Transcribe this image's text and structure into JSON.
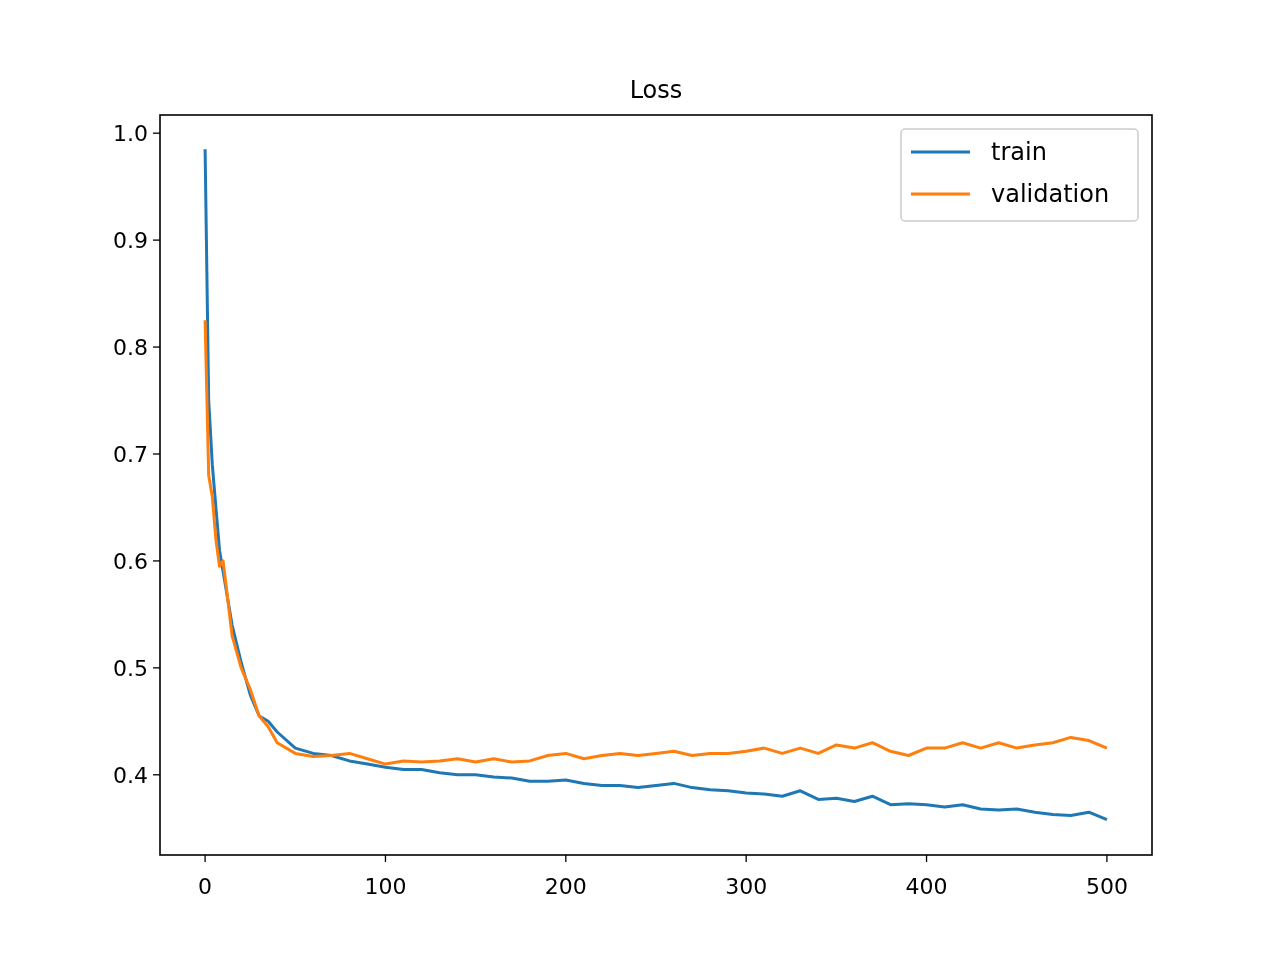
{
  "figure": {
    "chart_data": {
      "type": "line",
      "title": "Loss",
      "x": [
        0,
        2,
        4,
        6,
        8,
        10,
        15,
        20,
        25,
        30,
        35,
        40,
        50,
        60,
        70,
        80,
        90,
        100,
        110,
        120,
        130,
        140,
        150,
        160,
        170,
        180,
        190,
        200,
        210,
        220,
        230,
        240,
        250,
        260,
        270,
        280,
        290,
        300,
        310,
        320,
        330,
        340,
        350,
        360,
        370,
        380,
        390,
        400,
        410,
        420,
        430,
        440,
        450,
        460,
        470,
        480,
        490,
        500
      ],
      "series": [
        {
          "name": "train",
          "color": "#1f77b4",
          "values": [
            0.985,
            0.75,
            0.69,
            0.65,
            0.61,
            0.59,
            0.54,
            0.505,
            0.475,
            0.455,
            0.45,
            0.44,
            0.425,
            0.42,
            0.418,
            0.413,
            0.41,
            0.407,
            0.405,
            0.405,
            0.402,
            0.4,
            0.4,
            0.398,
            0.397,
            0.394,
            0.394,
            0.395,
            0.392,
            0.39,
            0.39,
            0.388,
            0.39,
            0.392,
            0.388,
            0.386,
            0.385,
            0.383,
            0.382,
            0.38,
            0.385,
            0.377,
            0.378,
            0.375,
            0.38,
            0.372,
            0.373,
            0.372,
            0.37,
            0.372,
            0.368,
            0.367,
            0.368,
            0.365,
            0.363,
            0.362,
            0.365,
            0.358
          ]
        },
        {
          "name": "validation",
          "color": "#ff7f0e",
          "values": [
            0.825,
            0.68,
            0.66,
            0.62,
            0.595,
            0.6,
            0.53,
            0.5,
            0.48,
            0.455,
            0.445,
            0.43,
            0.42,
            0.417,
            0.418,
            0.42,
            0.415,
            0.41,
            0.413,
            0.412,
            0.413,
            0.415,
            0.412,
            0.415,
            0.412,
            0.413,
            0.418,
            0.42,
            0.415,
            0.418,
            0.42,
            0.418,
            0.42,
            0.422,
            0.418,
            0.42,
            0.42,
            0.422,
            0.425,
            0.42,
            0.425,
            0.42,
            0.428,
            0.425,
            0.43,
            0.422,
            0.418,
            0.425,
            0.425,
            0.43,
            0.425,
            0.43,
            0.425,
            0.428,
            0.43,
            0.435,
            0.432,
            0.425
          ]
        }
      ],
      "legend": "upper right",
      "xlim": [
        -25,
        525
      ],
      "ylim": [
        0.325,
        1.017
      ],
      "xticks": [
        0,
        100,
        200,
        300,
        400,
        500
      ],
      "yticks": [
        {
          "value": 0.4,
          "label": "0.4"
        },
        {
          "value": 0.5,
          "label": "0.5"
        },
        {
          "value": 0.6,
          "label": "0.6"
        },
        {
          "value": 0.7,
          "label": "0.7"
        },
        {
          "value": 0.8,
          "label": "0.8"
        },
        {
          "value": 0.9,
          "label": "0.9"
        },
        {
          "value": 1.0,
          "label": "1.0"
        }
      ]
    }
  }
}
